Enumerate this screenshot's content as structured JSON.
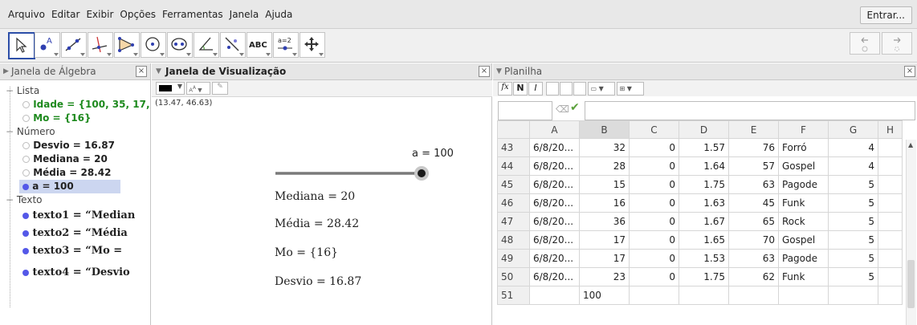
{
  "menu": [
    "Arquivo",
    "Editar",
    "Exibir",
    "Opções",
    "Ferramentas",
    "Janela",
    "Ajuda"
  ],
  "signin_label": "Entrar...",
  "toolbar": {
    "text_tool_label": "ABC",
    "slider_tool_label": "a=2"
  },
  "algebra": {
    "title": "Janela de Álgebra",
    "categories": {
      "lista": "Lista",
      "numero": "Número",
      "texto": "Texto"
    },
    "rows": {
      "idade": "Idade = {100, 35, 17, :",
      "mo": "Mo = {16}",
      "desvio": "Desvio = 16.87",
      "mediana": "Mediana = 20",
      "media": "Média = 28.42",
      "a": "a = 100",
      "texto1": "texto1 = “Median",
      "texto2": "texto2 = “Média",
      "texto3": "texto3 = “Mo   =",
      "texto4": "texto4 = “Desvio"
    },
    "colors": {
      "list_green": "#1e8a1e",
      "selected_bg": "#ccd6f0",
      "dot_blue": "#5458e8"
    }
  },
  "graphics": {
    "title": "Janela de Visualização",
    "coords": "(13.47, 46.63)",
    "slider_label": "a = 100",
    "slider_value": 1.0,
    "texts": {
      "mediana": "Mediana  =  20",
      "media": "Média  =  28.42",
      "mo": "Mo  =  {16}",
      "desvio": "Desvio  =  16.87"
    }
  },
  "spreadsheet": {
    "title": "Planilha",
    "format_buttons": {
      "bold": "N",
      "italic": "I"
    },
    "columns": [
      "A",
      "B",
      "C",
      "D",
      "E",
      "F",
      "G",
      "H"
    ],
    "rows": [
      {
        "n": "43",
        "A": "6/8/20...",
        "B": "32",
        "C": "0",
        "D": "1.57",
        "E": "76",
        "F": "Forró",
        "G": "4"
      },
      {
        "n": "44",
        "A": "6/8/20...",
        "B": "28",
        "C": "0",
        "D": "1.64",
        "E": "57",
        "F": "Gospel",
        "G": "4"
      },
      {
        "n": "45",
        "A": "6/8/20...",
        "B": "15",
        "C": "0",
        "D": "1.75",
        "E": "63",
        "F": "Pagode",
        "G": "5"
      },
      {
        "n": "46",
        "A": "6/8/20...",
        "B": "16",
        "C": "0",
        "D": "1.63",
        "E": "45",
        "F": "Funk",
        "G": "5"
      },
      {
        "n": "47",
        "A": "6/8/20...",
        "B": "36",
        "C": "0",
        "D": "1.67",
        "E": "65",
        "F": "Rock",
        "G": "5"
      },
      {
        "n": "48",
        "A": "6/8/20...",
        "B": "17",
        "C": "0",
        "D": "1.65",
        "E": "70",
        "F": "Gospel",
        "G": "5"
      },
      {
        "n": "49",
        "A": "6/8/20...",
        "B": "17",
        "C": "0",
        "D": "1.53",
        "E": "63",
        "F": "Pagode",
        "G": "5"
      },
      {
        "n": "50",
        "A": "6/8/20...",
        "B": "23",
        "C": "0",
        "D": "1.75",
        "E": "62",
        "F": "Funk",
        "G": "5"
      },
      {
        "n": "51",
        "A": "",
        "B": "100",
        "C": "",
        "D": "",
        "E": "",
        "F": "",
        "G": ""
      }
    ]
  }
}
